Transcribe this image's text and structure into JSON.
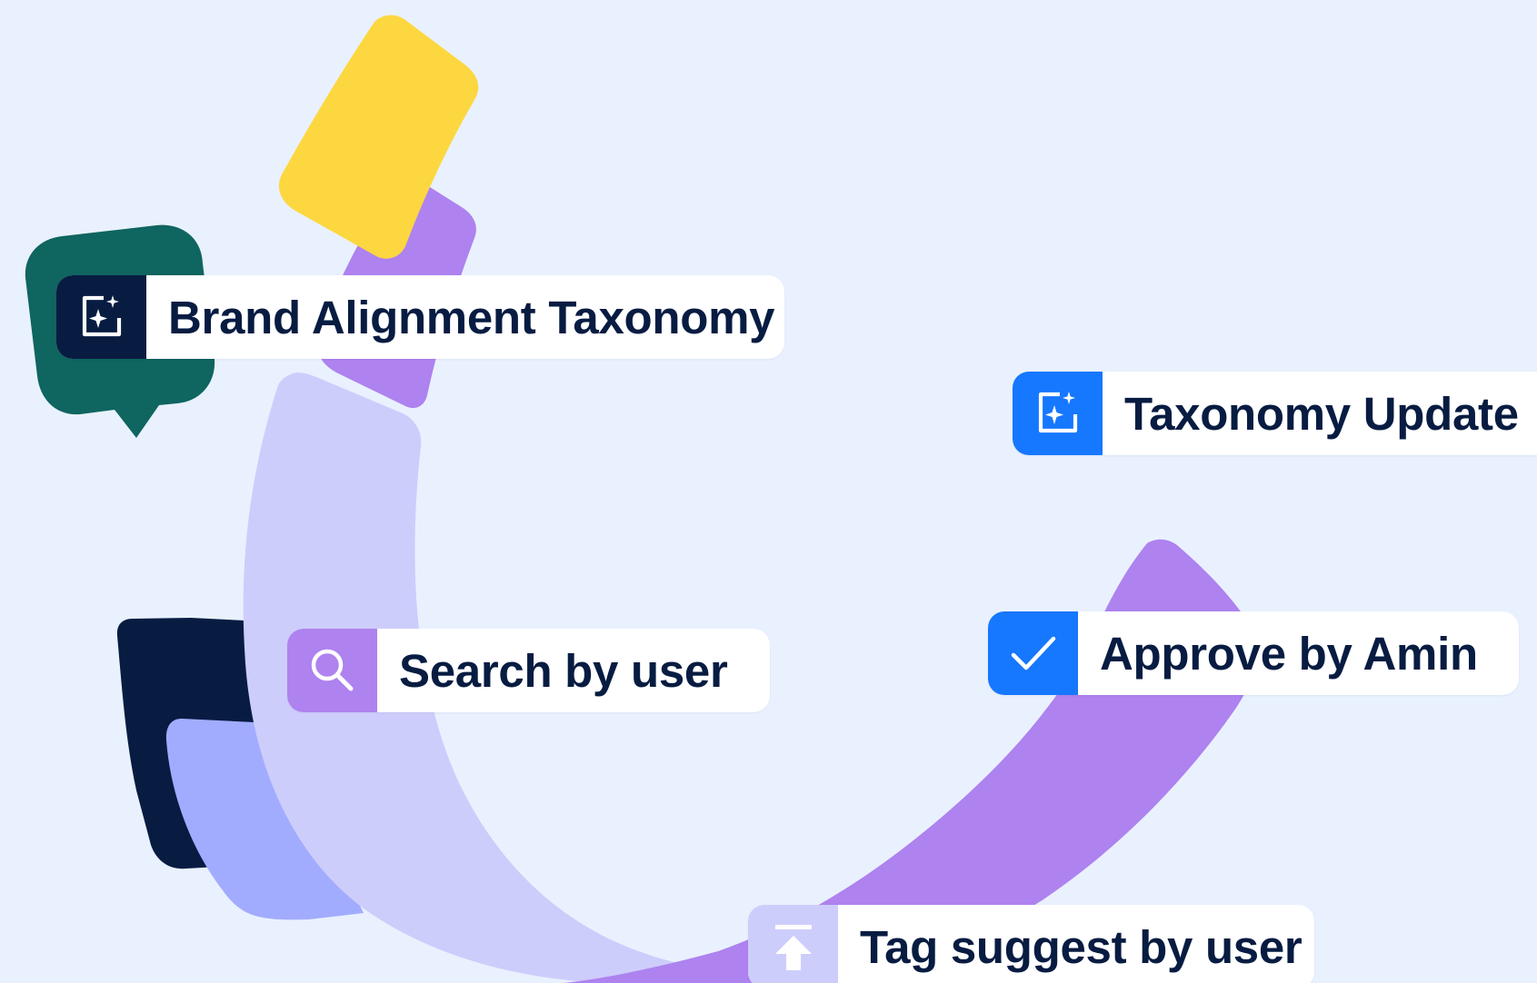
{
  "colors": {
    "background": "#e9f1fe",
    "navy": "#081c42",
    "blue": "#1677ff",
    "purple": "#ae82ef",
    "lavender": "#cdcdfc",
    "periwinkle": "#a2acff",
    "teal": "#0f6560",
    "yellow": "#fdd73f",
    "text": "#081c42"
  },
  "chips": {
    "brand_alignment": {
      "label": "Brand Alignment Taxonomy",
      "icon": "ai-sparkle-frame-icon"
    },
    "taxonomy_update": {
      "label": "Taxonomy Update",
      "icon": "ai-sparkle-frame-icon"
    },
    "search_by_user": {
      "label": "Search by user",
      "icon": "search-icon"
    },
    "approve_by_amin": {
      "label": "Approve by Amin",
      "icon": "checkmark-icon"
    },
    "tag_suggest": {
      "label": "Tag suggest by user",
      "icon": "upload-arrow-icon"
    }
  }
}
